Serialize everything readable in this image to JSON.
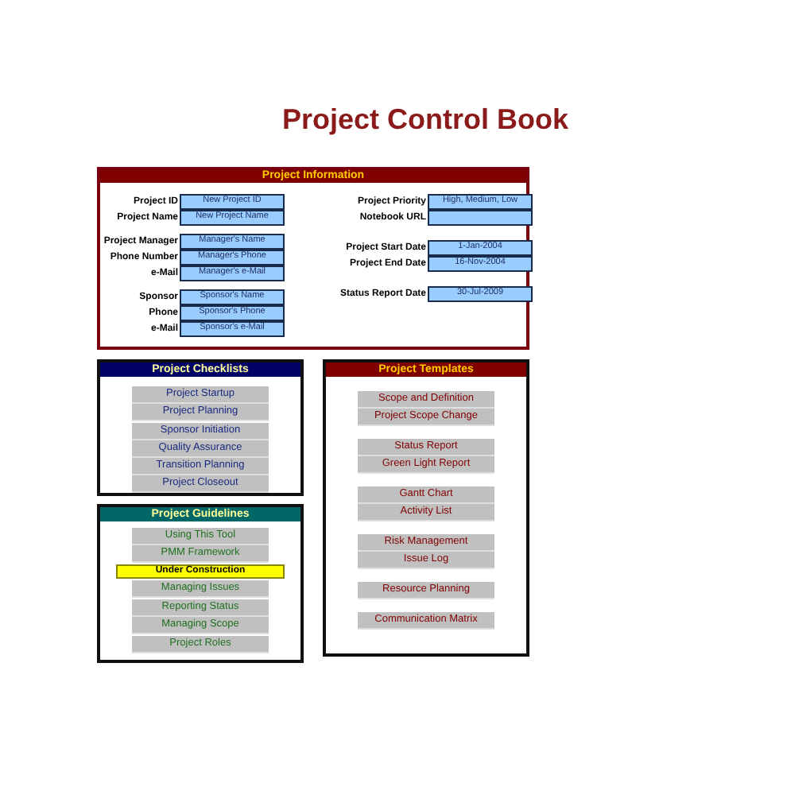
{
  "title": "Project Control Book",
  "project_information": {
    "heading": "Project Information",
    "left_groups": [
      [
        {
          "label": "Project ID",
          "value": "New Project ID"
        },
        {
          "label": "Project Name",
          "value": "New Project Name"
        }
      ],
      [
        {
          "label": "Project Manager",
          "value": "Manager's Name"
        },
        {
          "label": "Phone Number",
          "value": "Manager's Phone"
        },
        {
          "label": "e-Mail",
          "value": "Manager's e-Mail"
        }
      ],
      [
        {
          "label": "Sponsor",
          "value": "Sponsor's Name"
        },
        {
          "label": "Phone",
          "value": "Sponsor's Phone"
        },
        {
          "label": "e-Mail",
          "value": "Sponsor's e-Mail"
        }
      ]
    ],
    "right_groups": [
      [
        {
          "label": "Project Priority",
          "value": "High, Medium, Low"
        },
        {
          "label": "Notebook URL"
        }
      ],
      [
        {
          "label": "Project Start Date",
          "value": "1-Jan-2004"
        },
        {
          "label": "Project End Date",
          "value": "16-Nov-2004"
        }
      ],
      [
        {
          "label": "Status Report Date",
          "value": "30-Jul-2009"
        }
      ]
    ]
  },
  "checklists": {
    "heading": "Project Checklists",
    "groups": [
      [
        "Project Startup",
        "Project Planning"
      ],
      [
        "Sponsor Initiation",
        "Quality Assurance",
        "Transition Planning",
        "Project Closeout"
      ]
    ]
  },
  "guidelines": {
    "heading": "Project Guidelines",
    "banner": "Under Construction",
    "groups": [
      [
        "Using This Tool",
        "PMM Framework"
      ],
      [
        "Managing Issues"
      ],
      [
        "Reporting Status",
        "Managing Scope"
      ],
      [
        "Project Roles"
      ]
    ]
  },
  "templates": {
    "heading": "Project Templates",
    "groups": [
      [
        "Scope and Definition",
        "Project Scope Change"
      ],
      [
        "Status Report",
        "Green Light Report"
      ],
      [
        "Gantt Chart",
        "Activity List"
      ],
      [
        "Risk Management",
        "Issue Log"
      ],
      [
        "Resource Planning"
      ],
      [
        "Communication Matrix"
      ]
    ]
  }
}
